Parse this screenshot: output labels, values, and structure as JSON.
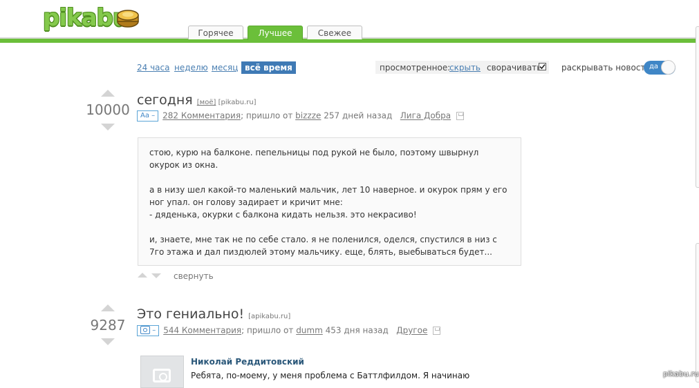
{
  "header": {
    "logo_text": "pikabu",
    "tabs": [
      {
        "label": "Горячее",
        "active": false
      },
      {
        "label": "Лучшее",
        "active": true
      },
      {
        "label": "Свежее",
        "active": false
      }
    ]
  },
  "filters": {
    "periods": [
      "24 часа",
      "неделю",
      "месяц",
      "всё время"
    ],
    "active_period": "всё время",
    "viewed_label": "просмотренное:",
    "viewed_action": "скрыть",
    "collapse_label": "сворачивать",
    "collapse_checked": true,
    "expand_news_label": "раскрывать новости",
    "expand_toggle_label": "да"
  },
  "posts": [
    {
      "rating": "10000",
      "title": "сегодня",
      "tag_mine": "[моё]",
      "source": "[pikabu.ru]",
      "type_badge": "Aa –",
      "comments": "282 Комментария",
      "from_prefix": "; пришло от",
      "author": "bizzze",
      "age": "257 дней назад",
      "community": "Лига Добра",
      "story": [
        "стою, курю на балконе. пепельницы под рукой не было, поэтому швырнул окурок из окна.",
        "а в низу шел какой-то маленький мальчик, лет 10 наверное. и окурок прям у его ног упал. он голову задирает и кричит мне:\n- дяденька, окурки с балкона кидать нельзя. это некрасиво!",
        "и, знаете, мне так не по себе стало. я не поленился, оделся, спустился в низ с 7го этажа и дал пиздюлей этому мальчику. еще, блять, выебываться будет..."
      ],
      "collapse_label": "свернуть"
    },
    {
      "rating": "9287",
      "title": "Это гениально!",
      "source": "[apikabu.ru]",
      "type_badge": "–",
      "comments": "544 Комментария",
      "from_prefix": "; пришло от",
      "author": "dumm",
      "age": "453 дня назад",
      "community": "Другое",
      "embed": {
        "name": "Николай Реддитовский",
        "text": "Ребята, по-моему, у меня проблема с Баттлфилдом. Я начинаю"
      }
    }
  ],
  "watermark": "pikabu.ru",
  "colors": {
    "brand_green": "#6bbf3a",
    "link_blue": "#4a7fb2",
    "toggle_blue": "#3f86c6"
  }
}
